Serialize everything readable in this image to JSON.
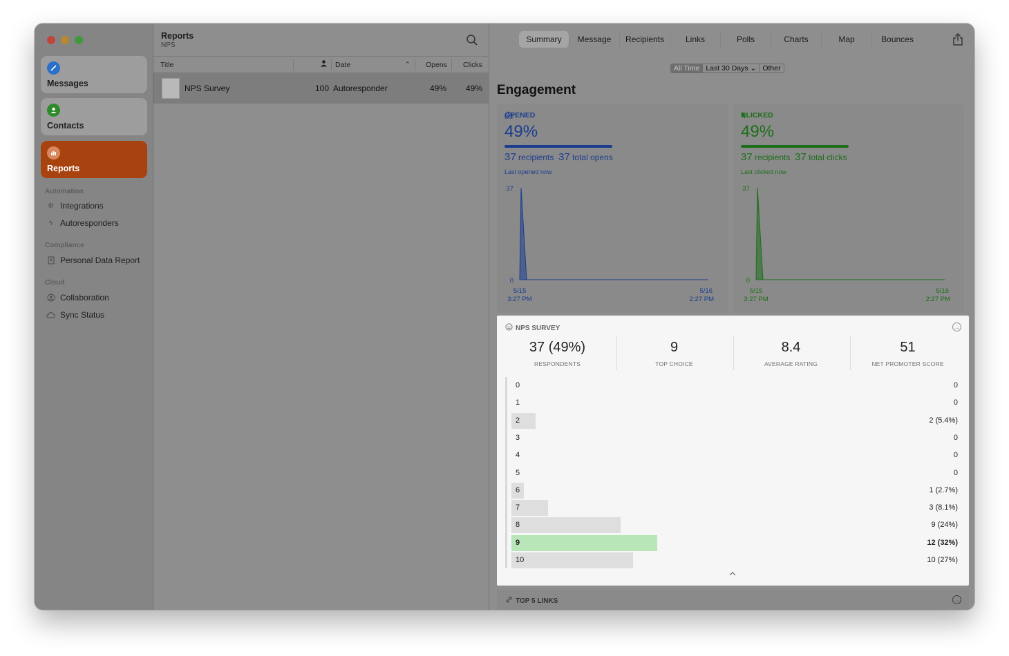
{
  "sidebar": {
    "nav": [
      {
        "label": "Messages",
        "icon": "compose-icon",
        "color": "#2b6fc9"
      },
      {
        "label": "Contacts",
        "icon": "person-icon",
        "color": "#2f8a2c"
      },
      {
        "label": "Reports",
        "icon": "chart-icon",
        "color": "#a8430f"
      }
    ],
    "sections": {
      "automation": "Automation",
      "compliance": "Compliance",
      "cloud": "Cloud"
    },
    "items": {
      "integrations": "Integrations",
      "autoresponders": "Autoresponders",
      "personal_data_report": "Personal Data Report",
      "collaboration": "Collaboration",
      "sync_status": "Sync Status"
    }
  },
  "list": {
    "title": "Reports",
    "subtitle": "NPS",
    "columns": {
      "title": "Title",
      "date": "Date",
      "opens": "Opens",
      "clicks": "Clicks"
    },
    "rows": [
      {
        "title": "NPS Survey",
        "recipients": "100",
        "date": "Autoresponder",
        "opens": "49%",
        "clicks": "49%"
      }
    ]
  },
  "tabs": [
    "Summary",
    "Message",
    "Recipients",
    "Links",
    "Polls",
    "Charts",
    "Map",
    "Bounces"
  ],
  "filters": [
    "All Time",
    "Last 30 Days ⌄",
    "Other"
  ],
  "engagement": {
    "title": "Engagement",
    "opened": {
      "label": "OPENED",
      "percent": "49%",
      "recipients_count": "37",
      "recipients_label": "recipients",
      "total_count": "37",
      "total_label": "total opens",
      "last": "Last opened now",
      "color": "#1a3d8f"
    },
    "clicked": {
      "label": "CLICKED",
      "percent": "49%",
      "recipients_count": "37",
      "recipients_label": "recipients",
      "total_count": "37",
      "total_label": "total clicks",
      "last": "Last clicked now",
      "color": "#1d6e1a"
    }
  },
  "chart_data": [
    {
      "type": "area",
      "name": "opened",
      "x": [
        "5/15 3:27 PM",
        "5/16 2:27 PM"
      ],
      "y_max_label": "37",
      "y_min_label": "0",
      "ylim": [
        0,
        37
      ],
      "values": [
        37,
        0
      ],
      "x_tick_labels": [
        [
          "5/15",
          "3:27 PM"
        ],
        [
          "5/16",
          "2:27 PM"
        ]
      ],
      "grid": false
    },
    {
      "type": "area",
      "name": "clicked",
      "x": [
        "5/15 3:27 PM",
        "5/16 2:27 PM"
      ],
      "y_max_label": "37",
      "y_min_label": "0",
      "ylim": [
        0,
        37
      ],
      "values": [
        37,
        0
      ],
      "x_tick_labels": [
        [
          "5/15",
          "3:27 PM"
        ],
        [
          "5/16",
          "2:27 PM"
        ]
      ],
      "grid": false
    },
    {
      "type": "bar",
      "name": "nps_distribution",
      "categories": [
        "0",
        "1",
        "2",
        "3",
        "4",
        "5",
        "6",
        "7",
        "8",
        "9",
        "10"
      ],
      "values": [
        0,
        0,
        2,
        0,
        0,
        0,
        1,
        3,
        9,
        12,
        10
      ],
      "labels": [
        "0",
        "0",
        "2 (5.4%)",
        "0",
        "0",
        "0",
        "1 (2.7%)",
        "3 (8.1%)",
        "9 (24%)",
        "12 (32%)",
        "10 (27%)"
      ],
      "highlight": "9"
    }
  ],
  "nps": {
    "header": "NPS SURVEY",
    "metrics": [
      {
        "value": "37 (49%)",
        "label": "RESPONDENTS"
      },
      {
        "value": "9",
        "label": "TOP CHOICE"
      },
      {
        "value": "8.4",
        "label": "AVERAGE RATING"
      },
      {
        "value": "51",
        "label": "NET PROMOTER SCORE"
      }
    ]
  },
  "links_section": {
    "header": "TOP 5 LINKS"
  }
}
